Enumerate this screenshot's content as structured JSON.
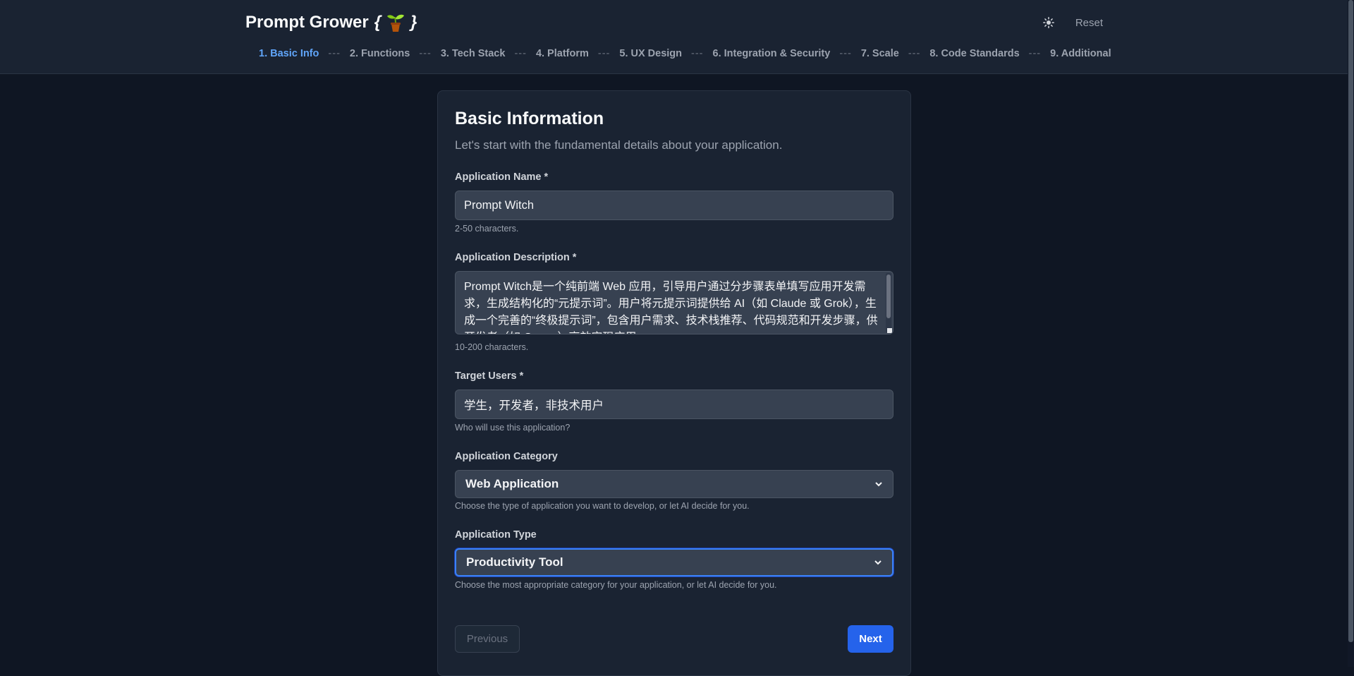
{
  "header": {
    "title": "Prompt Grower",
    "brace_open": "{",
    "brace_close": "}",
    "theme_toggle_icon": "sun-icon",
    "reset_label": "Reset"
  },
  "steps": [
    {
      "label": "1. Basic Info",
      "active": true
    },
    {
      "label": "2. Functions"
    },
    {
      "label": "3. Tech Stack"
    },
    {
      "label": "4. Platform"
    },
    {
      "label": "5. UX Design"
    },
    {
      "label": "6. Integration & Security"
    },
    {
      "label": "7. Scale"
    },
    {
      "label": "8. Code Standards"
    },
    {
      "label": "9. Additional"
    }
  ],
  "step_separator": "---",
  "form": {
    "title": "Basic Information",
    "subtitle": "Let's start with the fundamental details about your application.",
    "app_name": {
      "label": "Application Name *",
      "value": "Prompt Witch",
      "hint": "2-50 characters."
    },
    "app_description": {
      "label": "Application Description *",
      "value": "Prompt Witch是一个纯前端 Web 应用，引导用户通过分步骤表单填写应用开发需求，生成结构化的“元提示词”。用户将元提示词提供给 AI（如 Claude 或 Grok），生成一个完善的“终极提示词”，包含用户需求、技术栈推荐、代码规范和开发步骤，供开发者（如 Cursor）高效实现应用。",
      "hint": "10-200 characters."
    },
    "target_users": {
      "label": "Target Users *",
      "value": "学生，开发者，非技术用户",
      "hint": "Who will use this application?"
    },
    "app_category": {
      "label": "Application Category",
      "value": "Web Application",
      "hint": "Choose the type of application you want to develop, or let AI decide for you."
    },
    "app_type": {
      "label": "Application Type",
      "value": "Productivity Tool",
      "hint": "Choose the most appropriate category for your application, or let AI decide for you."
    },
    "previous_label": "Previous",
    "next_label": "Next"
  },
  "colors": {
    "accent": "#2563eb",
    "active_step": "#60a5fa",
    "background": "#0f1623",
    "card": "#1a2332"
  }
}
